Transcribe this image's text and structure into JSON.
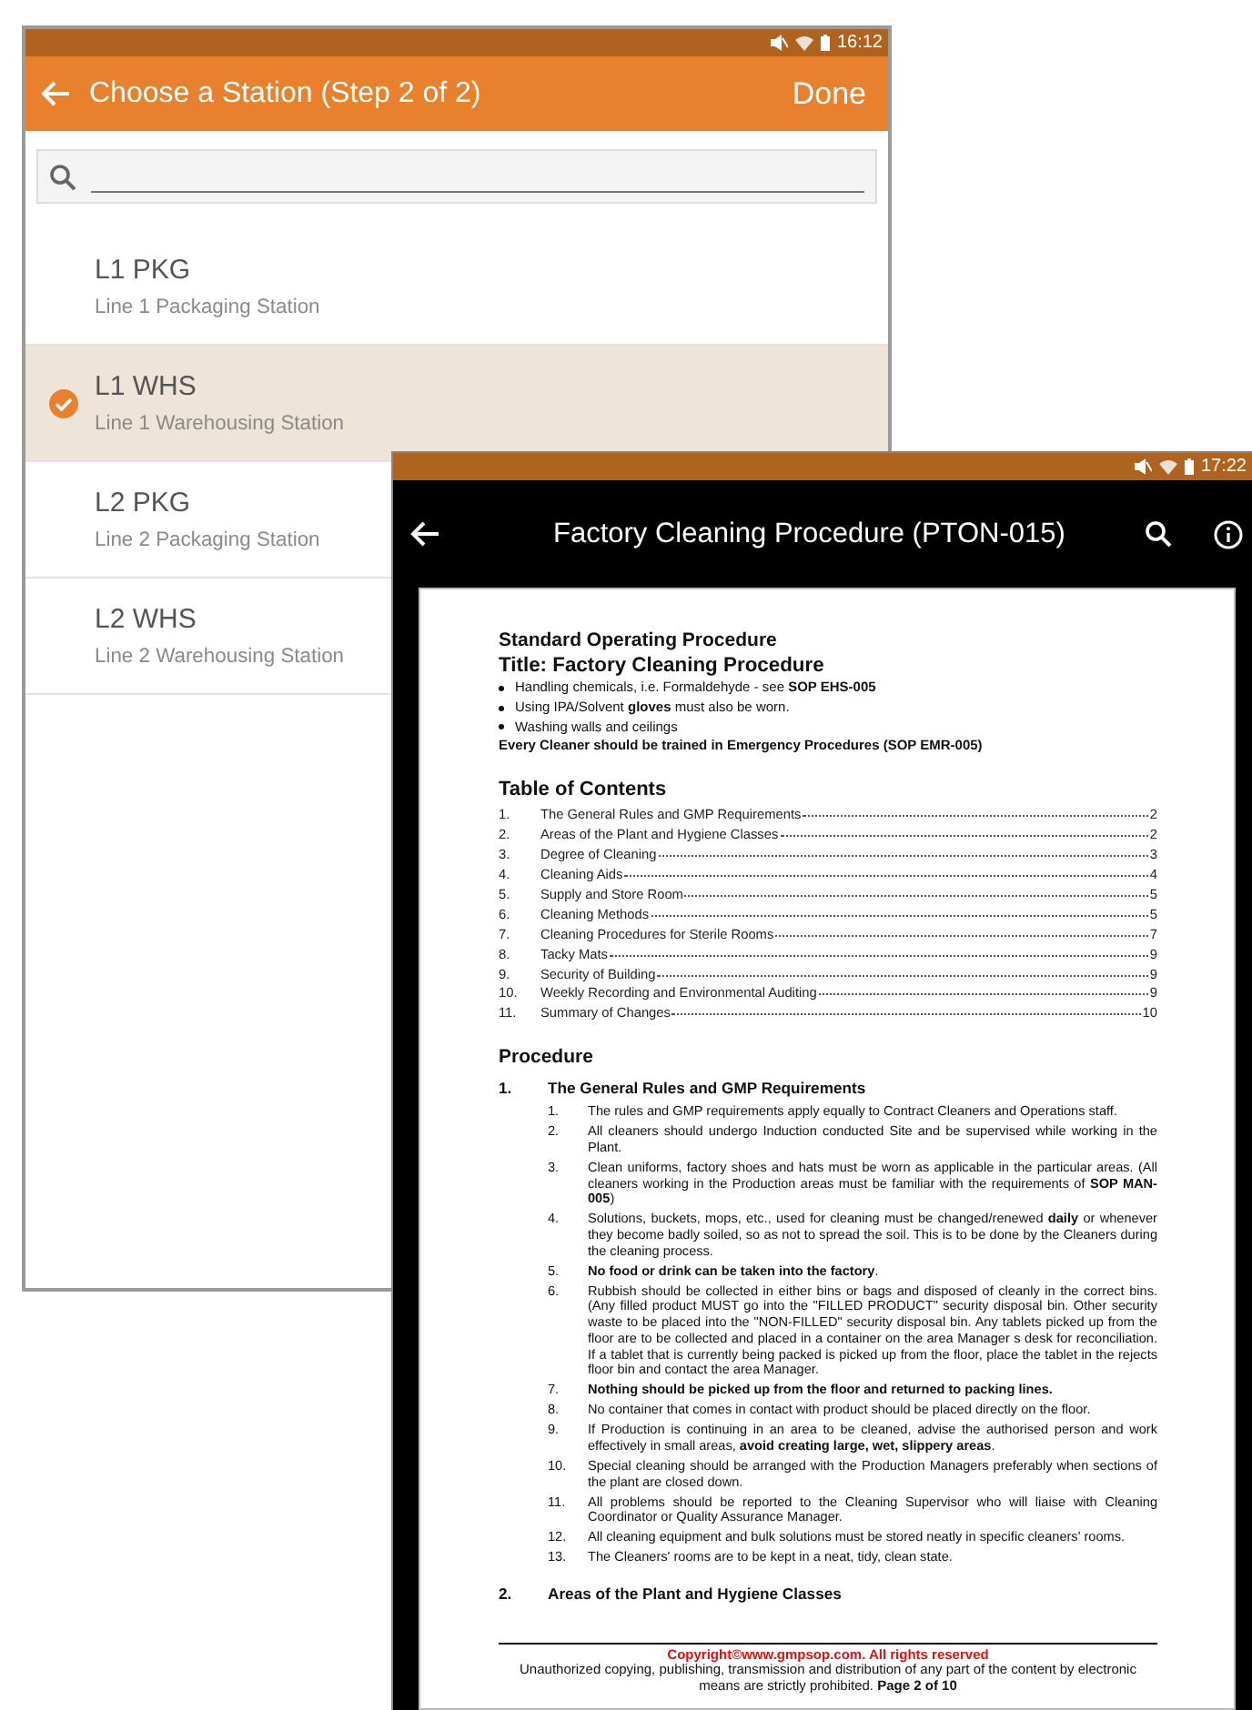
{
  "station_picker": {
    "status_bar": {
      "time": "16:12"
    },
    "toolbar": {
      "title": "Choose a Station (Step 2 of 2)",
      "action": "Done"
    },
    "stations": [
      {
        "code": "L1 PKG",
        "description": "Line 1 Packaging Station",
        "selected": false
      },
      {
        "code": "L1 WHS",
        "description": "Line 1 Warehousing Station",
        "selected": true
      },
      {
        "code": "L2 PKG",
        "description": "Line 2 Packaging Station",
        "selected": false
      },
      {
        "code": "L2 WHS",
        "description": "Line 2 Warehousing Station",
        "selected": false
      }
    ]
  },
  "document_viewer": {
    "status_bar": {
      "time": "17:22"
    },
    "toolbar": {
      "title": "Factory Cleaning Procedure (PTON-015)"
    },
    "page": {
      "heading": "Standard Operating Procedure",
      "title": "Title: Factory Cleaning Procedure",
      "bullets": [
        "Handling chemicals, i.e. Formaldehyde - see **SOP EHS-005**",
        "Using IPA/Solvent **gloves** must also be worn.",
        "Washing walls and ceilings"
      ],
      "note": "Every Cleaner should be trained in Emergency Procedures (SOP EMR-005)",
      "toc": {
        "heading": "Table of Contents",
        "entries": [
          {
            "number": "1.",
            "title": "The General Rules and GMP Requirements",
            "page": "2"
          },
          {
            "number": "2.",
            "title": "Areas of the Plant and Hygiene Classes",
            "page": "2"
          },
          {
            "number": "3.",
            "title": "Degree of Cleaning",
            "page": "3"
          },
          {
            "number": "4.",
            "title": "Cleaning Aids",
            "page": "4"
          },
          {
            "number": "5.",
            "title": "Supply and Store Room",
            "page": "5"
          },
          {
            "number": "6.",
            "title": "Cleaning Methods",
            "page": "5"
          },
          {
            "number": "7.",
            "title": "Cleaning Procedures for Sterile Rooms",
            "page": "7"
          },
          {
            "number": "8.",
            "title": "Tacky Mats",
            "page": "9"
          },
          {
            "number": "9.",
            "title": "Security of Building",
            "page": "9"
          },
          {
            "number": "10.",
            "title": "Weekly Recording and Environmental Auditing",
            "page": "9"
          },
          {
            "number": "11.",
            "title": "Summary of Changes",
            "page": "10"
          }
        ]
      },
      "procedure": {
        "heading": "Procedure",
        "sections": [
          {
            "number": "1.",
            "title": "The General Rules and GMP Requirements",
            "items": [
              {
                "number": "1.",
                "text": "The rules and GMP requirements apply equally to Contract Cleaners and Operations staff."
              },
              {
                "number": "2.",
                "text": "All cleaners should undergo Induction conducted Site and be supervised while working in the Plant."
              },
              {
                "number": "3.",
                "text": "Clean uniforms, factory shoes and hats must be worn as applicable in the particular areas. (All cleaners working in the Production areas must be familiar with the requirements of **SOP MAN-005**)"
              },
              {
                "number": "4.",
                "text": "Solutions, buckets, mops, etc., used for cleaning must be changed/renewed **daily** or whenever they become badly soiled, so as not to spread the soil.  This is to be done by the Cleaners during the cleaning process."
              },
              {
                "number": "5.",
                "text": "**No food or drink can be taken into the factory**."
              },
              {
                "number": "6.",
                "text": "Rubbish should be collected in either bins or bags and disposed of cleanly in the correct bins. (Any filled product MUST go into the \"FILLED PRODUCT\" security disposal bin.  Other security waste to be placed into the \"NON-FILLED\" security disposal bin. Any tablets picked up from the floor are to be collected and placed in a container on the area Manager s desk for reconciliation.  If a tablet that is currently being packed is picked up from the floor, place the tablet in the rejects floor bin and contact the area Manager."
              },
              {
                "number": "7.",
                "text": "**Nothing should be picked up from the floor and returned to packing lines.**"
              },
              {
                "number": "8.",
                "text": "No container that comes in contact with product should be placed directly on the floor."
              },
              {
                "number": "9.",
                "text": "If Production is continuing in an area to be cleaned, advise the authorised person and work effectively in small areas, **avoid creating large, wet, slippery areas**."
              },
              {
                "number": "10.",
                "text": "Special cleaning should be arranged with the Production Managers preferably when sections of the plant are closed down."
              },
              {
                "number": "11.",
                "text": "All problems should be reported to the Cleaning Supervisor who will liaise with Cleaning Coordinator or Quality Assurance Manager."
              },
              {
                "number": "12.",
                "text": "All cleaning equipment and bulk solutions must be stored neatly in specific cleaners' rooms."
              },
              {
                "number": "13.",
                "text": "The Cleaners' rooms are to be kept in a neat, tidy, clean state."
              }
            ]
          },
          {
            "number": "2.",
            "title": "Areas of the Plant and Hygiene Classes"
          }
        ]
      },
      "footer": {
        "copyright": "Copyright©www.gmpsop.com. All rights reserved",
        "notice": "Unauthorized copying, publishing, transmission and distribution of any part of the content by electronic means are strictly prohibited. **Page 2 of 10**"
      }
    }
  }
}
